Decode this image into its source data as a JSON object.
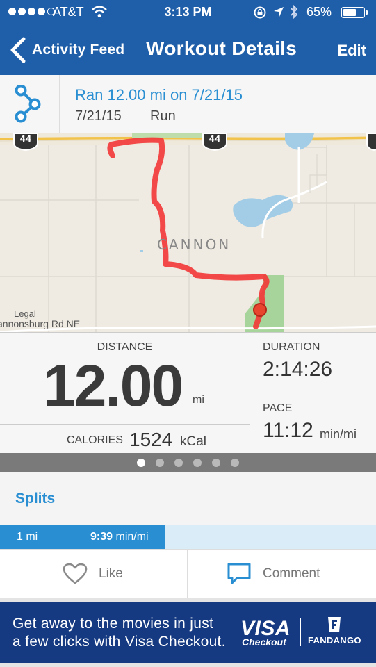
{
  "status_bar": {
    "carrier": "AT&T",
    "time": "3:13 PM",
    "battery_percent": "65%",
    "battery_level": 0.65
  },
  "nav": {
    "back_label": "Activity Feed",
    "title": "Workout Details",
    "edit_label": "Edit"
  },
  "activity": {
    "name": "Ran 12.00 mi on 7/21/15",
    "date": "7/21/15",
    "type": "Run",
    "icon": "route-icon"
  },
  "map": {
    "town_label": "CANNON",
    "legal_label": "Legal",
    "road_label": "annonsburg Rd NE",
    "highway_number": "44",
    "route_color": "#f23a3a"
  },
  "stats": {
    "distance_label": "DISTANCE",
    "distance_value": "12.00",
    "distance_unit": "mi",
    "calories_label": "CALORIES",
    "calories_value": "1524",
    "calories_unit": "kCal",
    "duration_label": "DURATION",
    "duration_value": "2:14:26",
    "pace_label": "PACE",
    "pace_value": "11:12",
    "pace_unit": "min/mi"
  },
  "pager": {
    "count": 6,
    "active_index": 0
  },
  "splits": {
    "label": "Splits",
    "rows": [
      {
        "distance": "1 mi",
        "pace": "9:39",
        "pace_unit": "min/mi",
        "fill": 0.44
      }
    ]
  },
  "actions": {
    "like_label": "Like",
    "comment_label": "Comment"
  },
  "ad": {
    "line1": "Get away to the movies in just",
    "line2": "a few clicks with Visa Checkout.",
    "brand1": "VISA",
    "brand1_sub": "Checkout",
    "brand2": "FANDANGO"
  },
  "colors": {
    "nav_blue": "#1f5ea8",
    "accent_blue": "#2a8fd2",
    "ad_blue": "#163a82"
  }
}
